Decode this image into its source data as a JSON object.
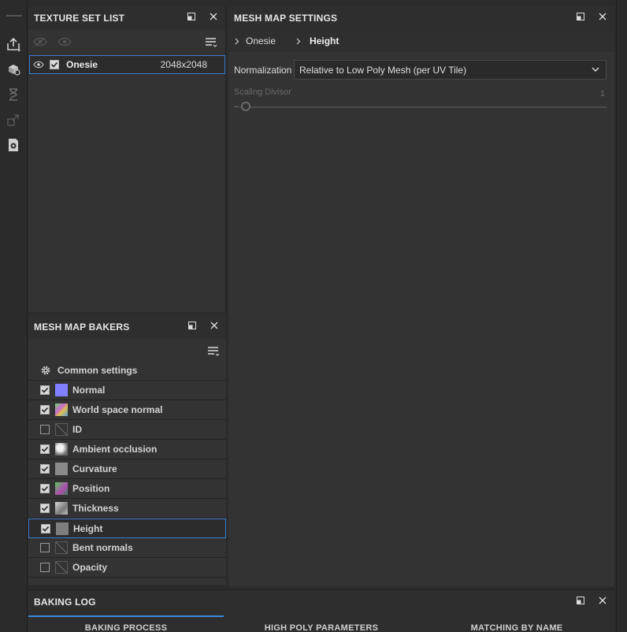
{
  "toolbar": {
    "icons": [
      "export-icon",
      "bake-icon",
      "hourglass-icon",
      "resize-icon",
      "document-icon"
    ]
  },
  "texture_set_list": {
    "title": "TEXTURE SET LIST",
    "items": [
      {
        "name": "Onesie",
        "resolution": "2048x2048",
        "checked": true,
        "visible": true
      }
    ]
  },
  "mesh_map_settings": {
    "title": "MESH MAP SETTINGS",
    "breadcrumb": [
      "Onesie",
      "Height"
    ],
    "normalization_label": "Normalization",
    "normalization_value": "Relative to Low Poly Mesh (per UV Tile)",
    "scaling_divisor_label": "Scaling Divisor",
    "scaling_divisor_value": "1"
  },
  "mesh_map_bakers": {
    "title": "MESH MAP BAKERS",
    "common_settings": "Common settings",
    "bakers": [
      {
        "label": "Normal",
        "checked": true,
        "thumb": "normal"
      },
      {
        "label": "World space normal",
        "checked": true,
        "thumb": "wsn"
      },
      {
        "label": "ID",
        "checked": false,
        "thumb": "empty"
      },
      {
        "label": "Ambient occlusion",
        "checked": true,
        "thumb": "ao"
      },
      {
        "label": "Curvature",
        "checked": true,
        "thumb": "curv"
      },
      {
        "label": "Position",
        "checked": true,
        "thumb": "pos"
      },
      {
        "label": "Thickness",
        "checked": true,
        "thumb": "thick"
      },
      {
        "label": "Height",
        "checked": true,
        "thumb": "height",
        "selected": true
      },
      {
        "label": "Bent normals",
        "checked": false,
        "thumb": "empty"
      },
      {
        "label": "Opacity",
        "checked": false,
        "thumb": "empty"
      }
    ]
  },
  "baking_log": {
    "title": "BAKING LOG",
    "tabs": [
      "BAKING PROCESS",
      "HIGH POLY PARAMETERS",
      "MATCHING BY NAME"
    ],
    "active_tab": 0
  },
  "colors": {
    "accent": "#3b7bd2",
    "panel_bg": "#333333",
    "header_bg": "#2e2e2e"
  }
}
